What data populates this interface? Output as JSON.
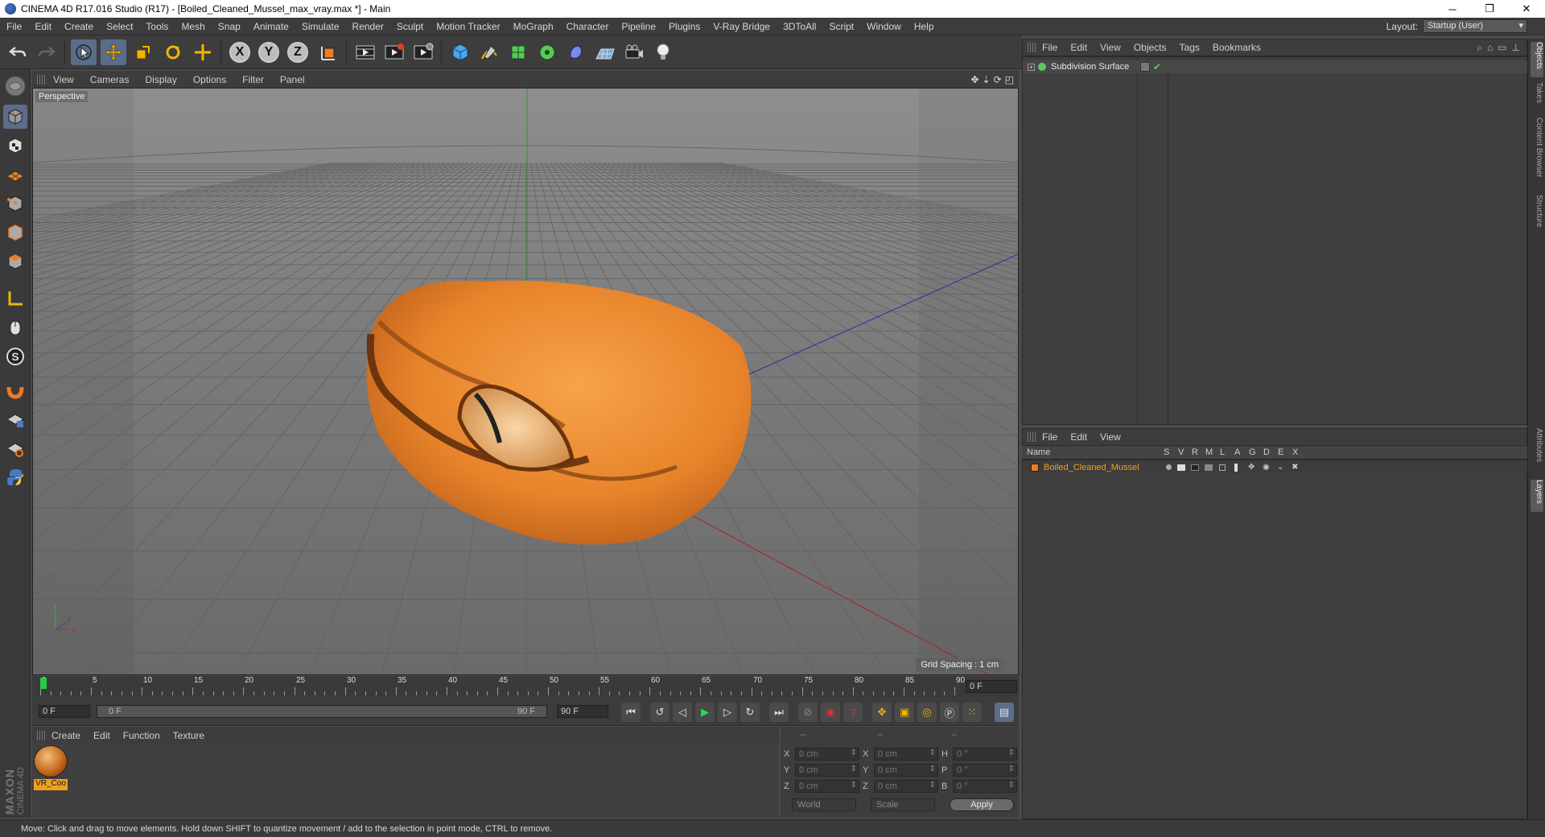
{
  "window": {
    "title": "CINEMA 4D R17.016 Studio (R17) - [Boiled_Cleaned_Mussel_max_vray.max *] - Main",
    "minimize": "─",
    "restore": "❐",
    "close": "✕"
  },
  "menubar": {
    "items": [
      "File",
      "Edit",
      "Create",
      "Select",
      "Tools",
      "Mesh",
      "Snap",
      "Animate",
      "Simulate",
      "Render",
      "Sculpt",
      "Motion Tracker",
      "MoGraph",
      "Character",
      "Pipeline",
      "Plugins",
      "V-Ray Bridge",
      "3DToAll",
      "Script",
      "Window",
      "Help"
    ],
    "layout_label": "Layout:",
    "layout_value": "Startup (User)"
  },
  "toolbar": {
    "x_label": "X",
    "y_label": "Y",
    "z_label": "Z"
  },
  "viewport": {
    "menu": [
      "View",
      "Cameras",
      "Display",
      "Options",
      "Filter",
      "Panel"
    ],
    "label": "Perspective",
    "grid_spacing": "Grid Spacing : 1 cm",
    "axis_x": "x",
    "axis_y": "y",
    "axis_z": "z"
  },
  "timeline": {
    "ticks": [
      "0",
      "5",
      "10",
      "15",
      "20",
      "25",
      "30",
      "35",
      "40",
      "45",
      "50",
      "55",
      "60",
      "65",
      "70",
      "75",
      "80",
      "85",
      "90"
    ],
    "current_frame_display": "0 F",
    "start_frame": "0 F",
    "range_start": "0 F",
    "range_end": "90 F",
    "end_frame": "90 F"
  },
  "material_manager": {
    "menu": [
      "Create",
      "Edit",
      "Function",
      "Texture"
    ],
    "materials": [
      {
        "label": "VR_Coo"
      }
    ]
  },
  "coordinates": {
    "header": [
      "--",
      "--",
      "--"
    ],
    "rows": [
      {
        "pos_label": "X",
        "pos_value": "0 cm",
        "size_label": "X",
        "size_value": "0 cm",
        "rot_label": "H",
        "rot_value": "0 °"
      },
      {
        "pos_label": "Y",
        "pos_value": "0 cm",
        "size_label": "Y",
        "size_value": "0 cm",
        "rot_label": "P",
        "rot_value": "0 °"
      },
      {
        "pos_label": "Z",
        "pos_value": "0 cm",
        "size_label": "Z",
        "size_value": "0 cm",
        "rot_label": "B",
        "rot_value": "0 °"
      }
    ],
    "mode_select": "World",
    "scale_select": "Scale",
    "apply": "Apply"
  },
  "object_manager": {
    "menu": [
      "File",
      "Edit",
      "View",
      "Objects",
      "Tags",
      "Bookmarks"
    ],
    "objects": [
      {
        "name": "Subdivision Surface"
      }
    ]
  },
  "layer_manager": {
    "menu": [
      "File",
      "Edit",
      "View"
    ],
    "columns": {
      "name": "Name",
      "flags": [
        "S",
        "V",
        "R",
        "M",
        "L",
        "A",
        "G",
        "D",
        "E",
        "X"
      ]
    },
    "layers": [
      {
        "name": "Boiled_Cleaned_Mussel",
        "color": "#f07a20"
      }
    ]
  },
  "right_tabs": [
    "Objects",
    "Takes",
    "Content Browser",
    "Structure",
    "Attributes",
    "Layers"
  ],
  "branding": {
    "line1": "MAXON",
    "line2": "CINEMA 4D"
  },
  "status": {
    "text": "Move: Click and drag to move elements. Hold down SHIFT to quantize movement / add to the selection in point mode, CTRL to remove."
  },
  "colors": {
    "accent": "#5a6d8a",
    "playhead": "#22cc44",
    "object_orange": "#e8892a",
    "layer_orange": "#f0a020"
  }
}
